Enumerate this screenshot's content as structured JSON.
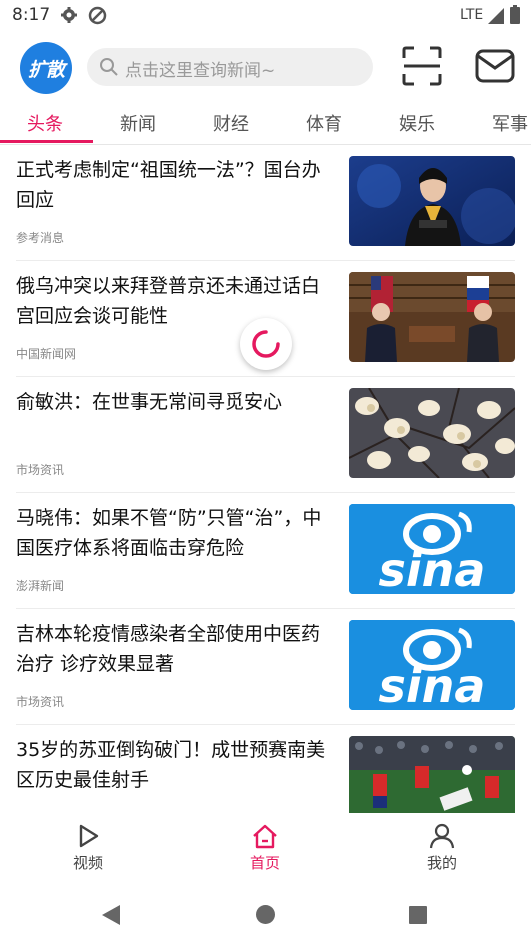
{
  "status": {
    "time": "8:17",
    "network": "LTE"
  },
  "header": {
    "logo_text": "扩散",
    "search_placeholder": "点击这里查询新闻~"
  },
  "tabs": [
    {
      "label": "头条",
      "active": true
    },
    {
      "label": "新闻"
    },
    {
      "label": "财经"
    },
    {
      "label": "体育"
    },
    {
      "label": "娱乐"
    },
    {
      "label": "军事"
    }
  ],
  "feed": [
    {
      "title": "正式考虑制定“祖国统一法”？国台办回应",
      "source": "参考消息"
    },
    {
      "title": "俄乌冲突以来拜登普京还未通过话白宫回应会谈可能性",
      "source": "中国新闻网"
    },
    {
      "title": "俞敏洪：在世事无常间寻觅安心",
      "source": "市场资讯"
    },
    {
      "title": "马晓伟：如果不管“防”只管“治”，中国医疗体系将面临击穿危险",
      "source": "澎湃新闻",
      "thumb_text": "sina"
    },
    {
      "title": "吉林本轮疫情感染者全部使用中医药治疗 诊疗效果显著",
      "source": "市场资讯",
      "thumb_text": "sina"
    },
    {
      "title": "35岁的苏亚倒钩破门！成世预赛南美区历史最佳射手",
      "source": ""
    }
  ],
  "bottom_nav": [
    {
      "label": "视频"
    },
    {
      "label": "首页",
      "active": true
    },
    {
      "label": "我的"
    }
  ],
  "colors": {
    "accent": "#e5195f",
    "logo_blue": "#1f7fe0",
    "sina_blue": "#1a8fe0"
  }
}
